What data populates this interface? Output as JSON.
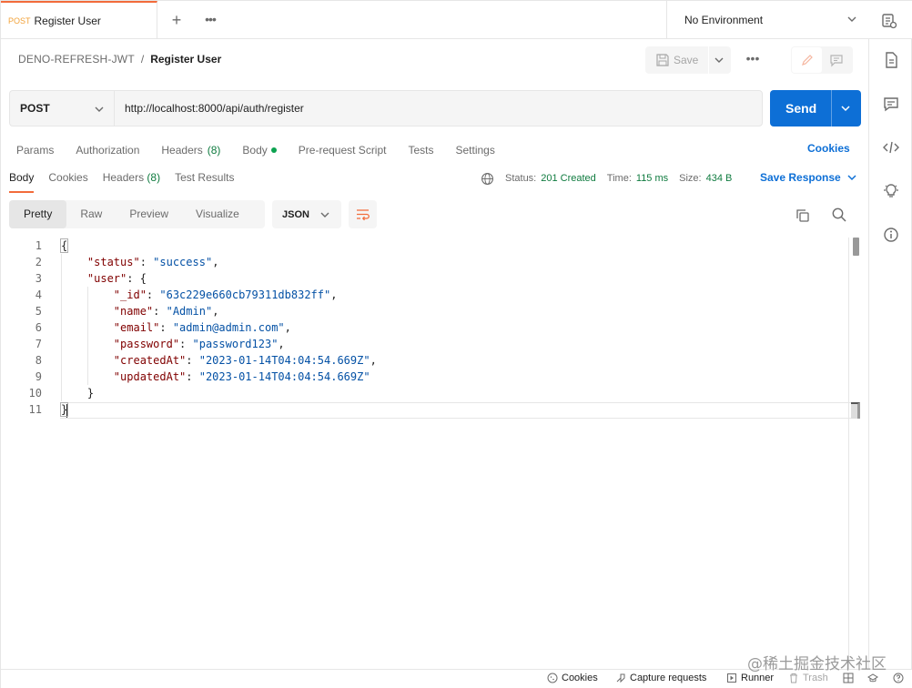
{
  "tab": {
    "method": "POST",
    "name": "Register User"
  },
  "environment": {
    "label": "No Environment"
  },
  "breadcrumb": {
    "collection": "DENO-REFRESH-JWT",
    "separator": "/",
    "current": "Register User"
  },
  "toolbar": {
    "save_label": "Save"
  },
  "request": {
    "method": "POST",
    "url": "http://localhost:8000/api/auth/register",
    "send_label": "Send"
  },
  "request_tabs": [
    {
      "label": "Params"
    },
    {
      "label": "Authorization"
    },
    {
      "label": "Headers",
      "count": "(8)"
    },
    {
      "label": "Body"
    },
    {
      "label": "Pre-request Script"
    },
    {
      "label": "Tests"
    },
    {
      "label": "Settings"
    }
  ],
  "cookies_label": "Cookies",
  "response_tabs": [
    {
      "label": "Body"
    },
    {
      "label": "Cookies"
    },
    {
      "label": "Headers",
      "count": "(8)"
    },
    {
      "label": "Test Results"
    }
  ],
  "status": {
    "status_label": "Status:",
    "status_value": "201 Created",
    "time_label": "Time:",
    "time_value": "115 ms",
    "size_label": "Size:",
    "size_value": "434 B"
  },
  "save_response_label": "Save Response",
  "format_buttons": [
    "Pretty",
    "Raw",
    "Preview",
    "Visualize"
  ],
  "format_selected": "JSON",
  "response_body": {
    "line_numbers": [
      "1",
      "2",
      "3",
      "4",
      "5",
      "6",
      "7",
      "8",
      "9",
      "10",
      "11"
    ],
    "lines": [
      "{",
      "    \"status\": \"success\",",
      "    \"user\": {",
      "        \"_id\": \"63c229e660cb79311db832ff\",",
      "        \"name\": \"Admin\",",
      "        \"email\": \"admin@admin.com\",",
      "        \"password\": \"password123\",",
      "        \"createdAt\": \"2023-01-14T04:04:54.669Z\",",
      "        \"updatedAt\": \"2023-01-14T04:04:54.669Z\"",
      "    }",
      "}"
    ]
  },
  "footer": {
    "cookies": "Cookies",
    "capture": "Capture requests",
    "runner": "Runner",
    "trash": "Trash"
  },
  "watermark": "@稀土掘金技术社区",
  "colors": {
    "accent_orange": "#f26b3a",
    "send_blue": "#0d6fd6",
    "status_green": "#0f7b3f",
    "json_key": "#800000",
    "json_string": "#0451a5"
  }
}
